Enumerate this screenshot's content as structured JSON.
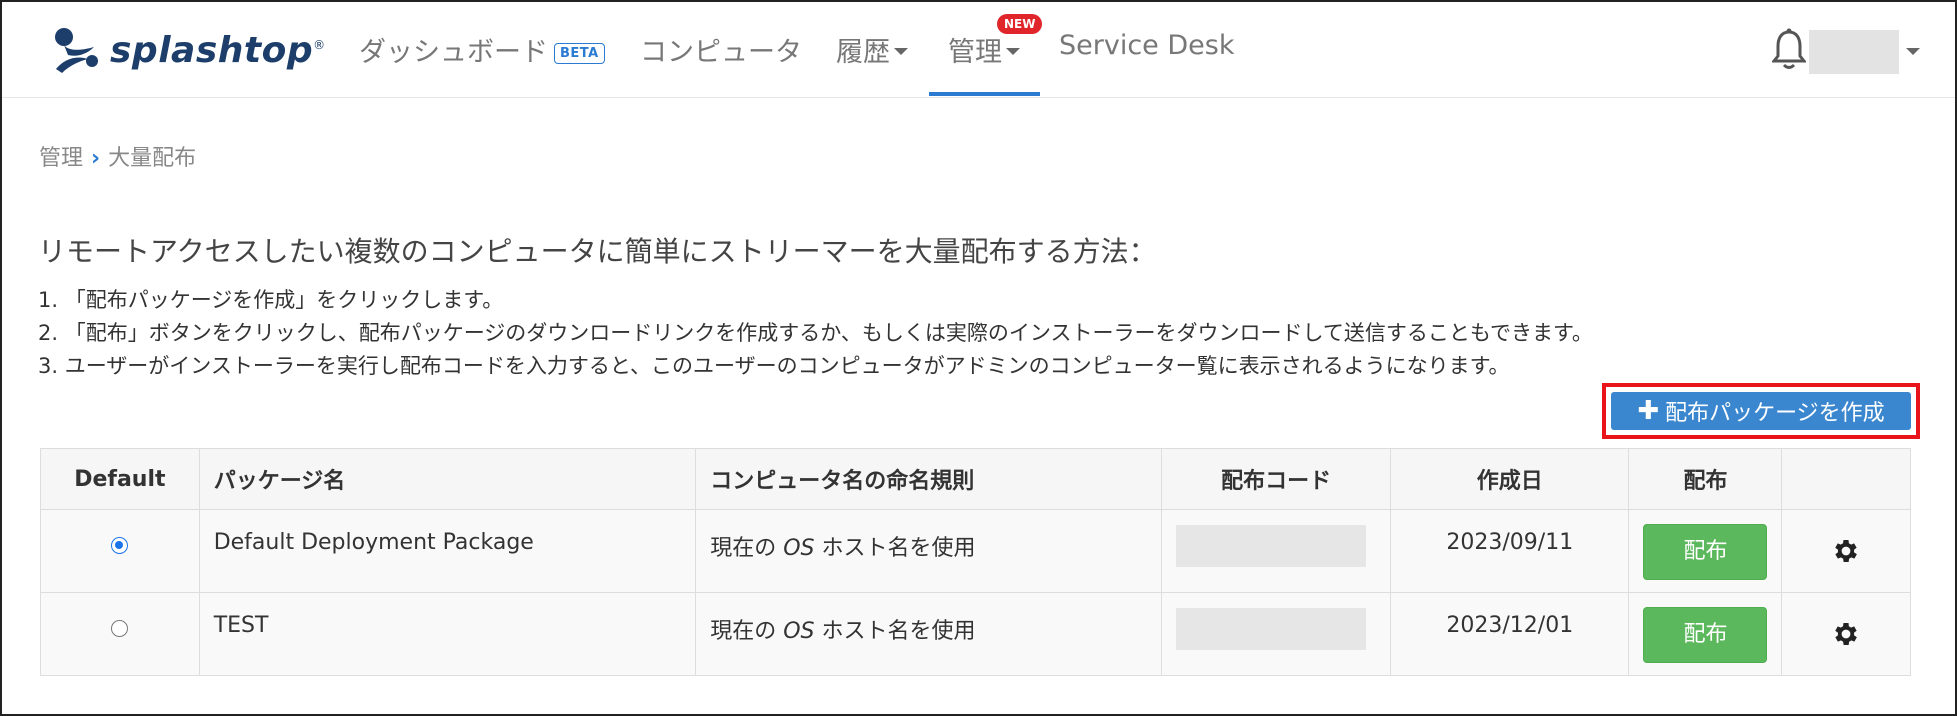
{
  "nav": {
    "logo_text": "splashtop",
    "logo_mark": "®",
    "items": [
      {
        "label": "ダッシュボード",
        "badge": "BETA"
      },
      {
        "label": "コンピュータ"
      },
      {
        "label": "履歴"
      },
      {
        "label": "管理",
        "badge": "NEW"
      },
      {
        "label": "Service Desk"
      }
    ],
    "active_index": 3
  },
  "breadcrumb": {
    "parent": "管理",
    "current": "大量配布"
  },
  "heading": "リモートアクセスしたい複数のコンピュータに簡単にストリーマーを大量配布する方法：",
  "steps": [
    "1. 「配布パッケージを作成」をクリックします。",
    "2. 「配布」ボタンをクリックし、配布パッケージのダウンロードリンクを作成するか、もしくは実際のインストーラーをダウンロードして送信することもできます。",
    "3. ユーザーがインストーラーを実行し配布コードを入力すると、このユーザーのコンピュータがアドミンのコンピューター覧に表示されるようになります。"
  ],
  "create_button": {
    "label": "配布パッケージを作成",
    "icon": "plus-icon"
  },
  "table": {
    "headers": [
      "Default",
      "パッケージ名",
      "コンピュータ名の命名規則",
      "配布コード",
      "作成日",
      "配布",
      ""
    ],
    "rows": [
      {
        "default": true,
        "name": "Default Deployment Package",
        "naming_prefix": "現在の ",
        "naming_os": "OS",
        "naming_suffix": " ホスト名を使用",
        "code": "",
        "date": "2023/09/11",
        "deploy_label": "配布"
      },
      {
        "default": false,
        "name": "TEST",
        "naming_prefix": "現在の ",
        "naming_os": "OS",
        "naming_suffix": " ホスト名を使用",
        "code": "",
        "date": "2023/12/01",
        "deploy_label": "配布"
      }
    ]
  },
  "colors": {
    "accent": "#2a7bd1",
    "deploy": "#5cb85c",
    "highlight": "#e8141a",
    "new_badge": "#e0262b"
  }
}
